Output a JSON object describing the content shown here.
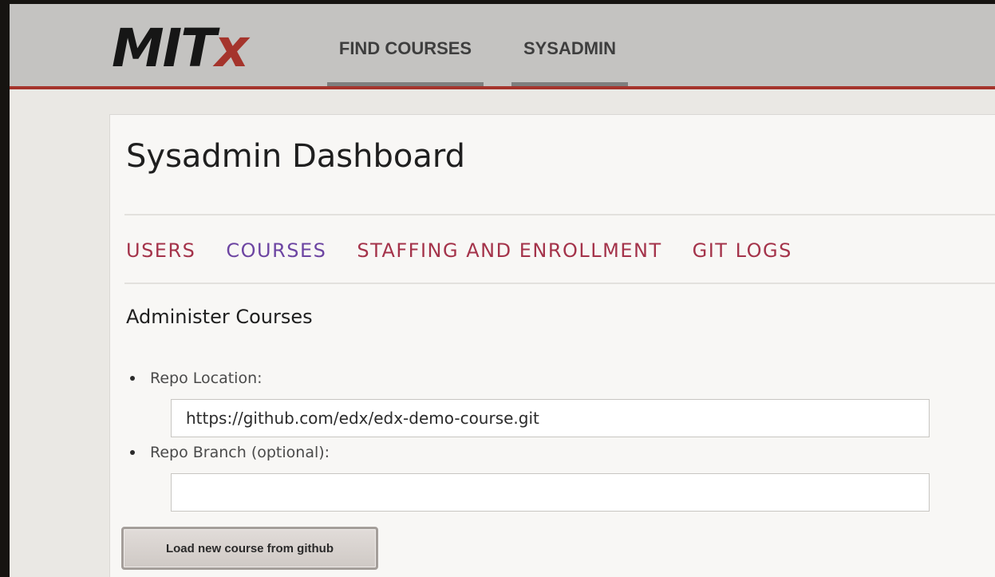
{
  "header": {
    "logo_main": "MIT",
    "logo_x": "x",
    "nav": [
      {
        "label": "FIND COURSES"
      },
      {
        "label": "SYSADMIN"
      }
    ]
  },
  "main": {
    "title": "Sysadmin Dashboard",
    "tabs": [
      {
        "label": "USERS",
        "color": "#a4334a"
      },
      {
        "label": "COURSES",
        "color": "#6d45a2"
      },
      {
        "label": "STAFFING AND ENROLLMENT",
        "color": "#a4334a"
      },
      {
        "label": "GIT LOGS",
        "color": "#a4334a"
      }
    ],
    "section_title": "Administer Courses",
    "form": {
      "repo_location_label": "Repo Location:",
      "repo_location_value": "https://github.com/edx/edx-demo-course.git",
      "repo_branch_label": "Repo Branch (optional):",
      "repo_branch_value": "",
      "submit_label": "Load new course from github"
    }
  },
  "colors": {
    "brand_red": "#a5342c",
    "link": "#a4334a",
    "link_visited": "#6d45a2"
  }
}
